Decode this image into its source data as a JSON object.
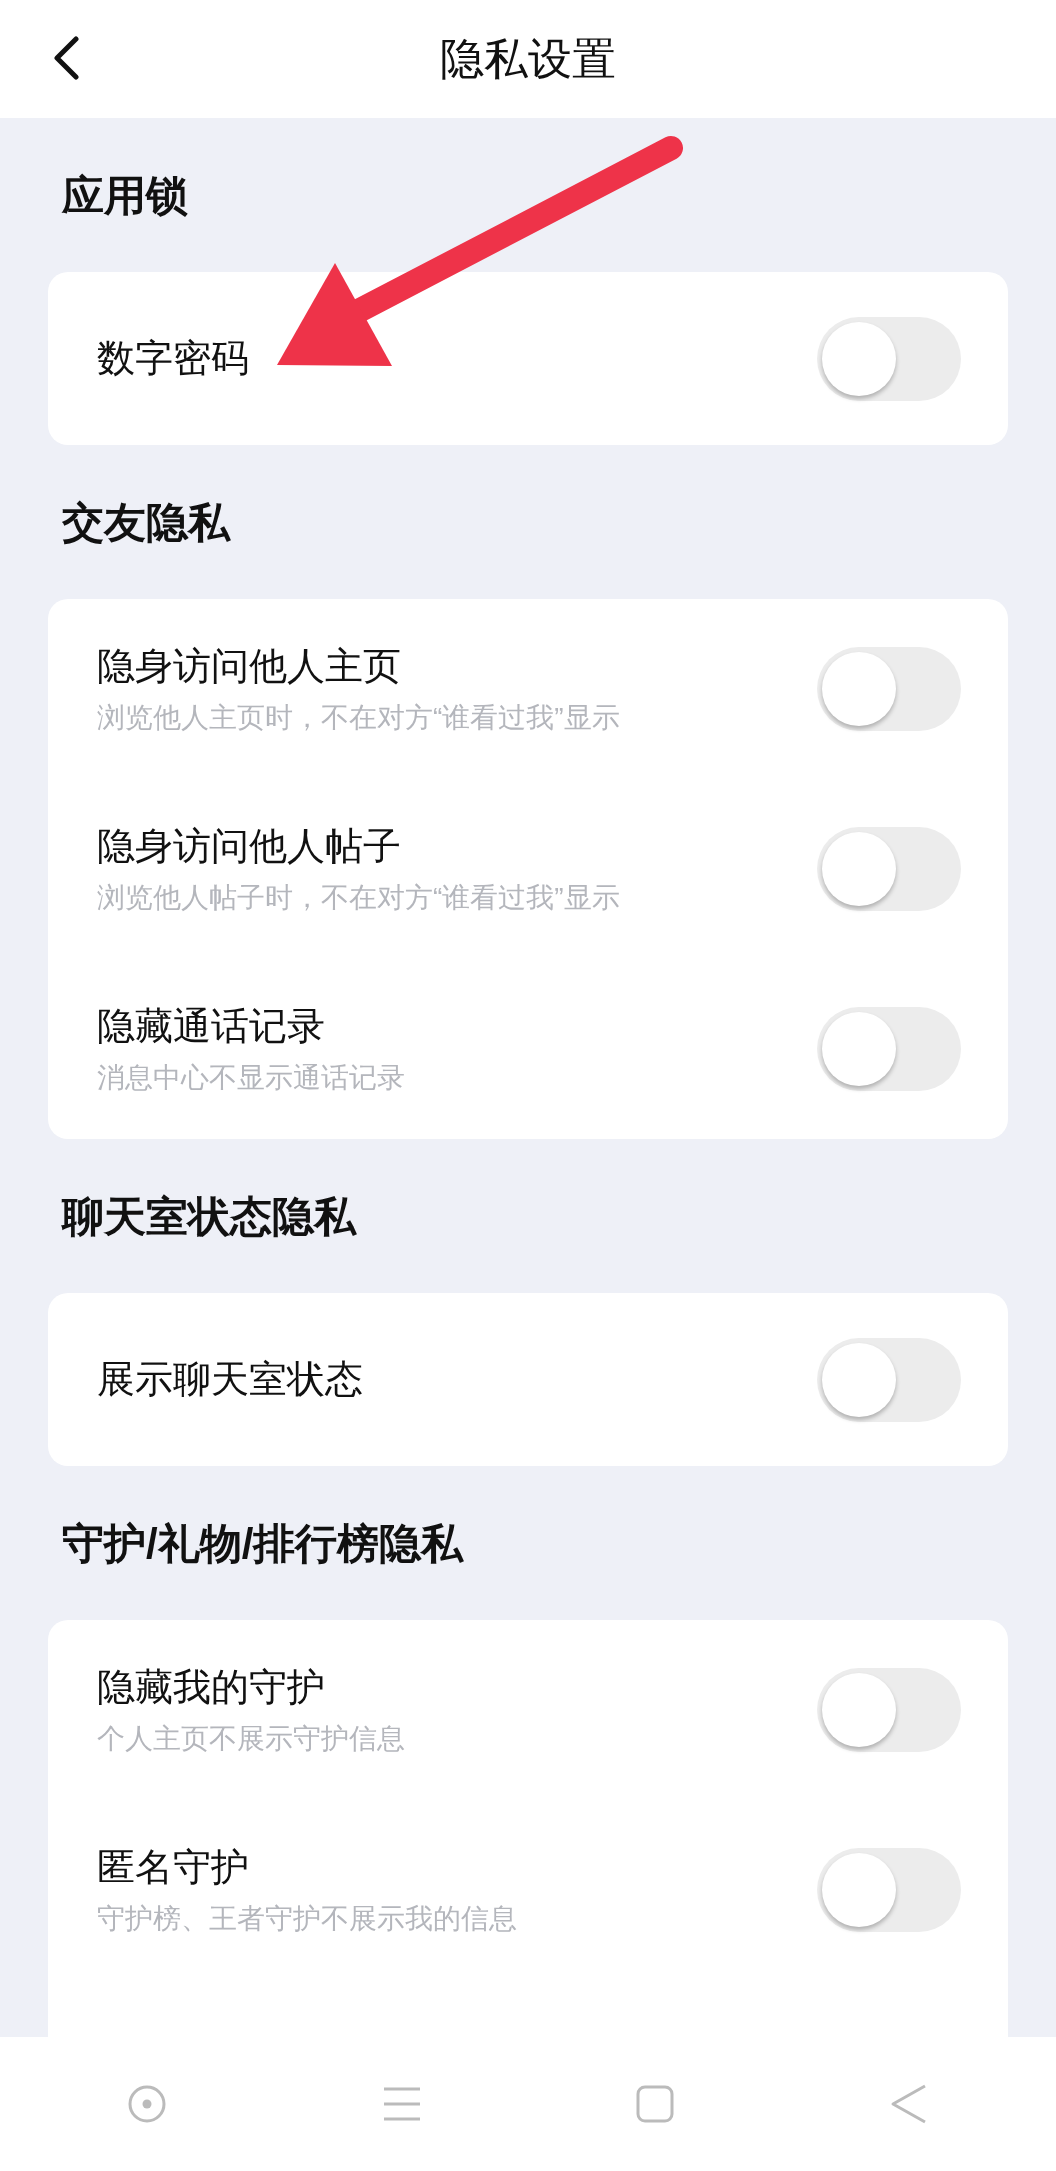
{
  "header": {
    "title": "隐私设置"
  },
  "sections": [
    {
      "title": "应用锁",
      "items": [
        {
          "label": "数字密码",
          "on": false
        }
      ]
    },
    {
      "title": "交友隐私",
      "items": [
        {
          "label": "隐身访问他人主页",
          "description": "浏览他人主页时，不在对方“谁看过我”显示",
          "on": false
        },
        {
          "label": "隐身访问他人帖子",
          "description": "浏览他人帖子时，不在对方“谁看过我”显示",
          "on": false
        },
        {
          "label": "隐藏通话记录",
          "description": "消息中心不显示通话记录",
          "on": false
        }
      ]
    },
    {
      "title": "聊天室状态隐私",
      "items": [
        {
          "label": "展示聊天室状态",
          "on": false
        }
      ]
    },
    {
      "title": "守护/礼物/排行榜隐私",
      "items": [
        {
          "label": "隐藏我的守护",
          "description": "个人主页不展示守护信息",
          "on": false
        },
        {
          "label": "匿名守护",
          "description": "守护榜、王者守护不展示我的信息",
          "on": false
        }
      ]
    }
  ]
}
